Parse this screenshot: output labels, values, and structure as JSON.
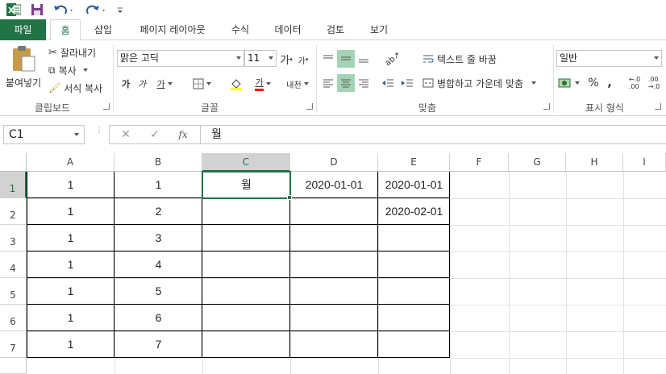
{
  "quick_access": {
    "app_icon": "excel-icon",
    "save_icon": "save-icon",
    "undo_icon": "undo-icon",
    "redo_icon": "redo-icon",
    "customize_icon": "customize-qat-icon"
  },
  "tabs": [
    "파일",
    "홈",
    "삽입",
    "페이지 레이아웃",
    "수식",
    "데이터",
    "검토",
    "보기"
  ],
  "ribbon": {
    "clipboard": {
      "paste": "붙여넣기",
      "cut": "잘라내기",
      "copy": "복사",
      "format_painter": "서식 복사",
      "label": "클립보드"
    },
    "font": {
      "name": "맑은 고딕",
      "size": "11",
      "grow": "가",
      "shrink": "가",
      "bold": "가",
      "italic": "가",
      "underline": "가",
      "font_color_glyph": "가",
      "phonetic": "내천",
      "label": "글꼴",
      "fill_color": "#ffff00",
      "font_color": "#ff0000"
    },
    "alignment": {
      "wrap_text": "텍스트 줄 바꿈",
      "merge_center": "병합하고 가운데 맞춤",
      "label": "맞춤"
    },
    "number": {
      "format": "일반",
      "percent": "%",
      "comma": ",",
      "label": "표시 형식"
    }
  },
  "formula_bar": {
    "name_box": "C1",
    "cancel": "✕",
    "enter": "✓",
    "fx": "fx",
    "content": "월"
  },
  "columns": [
    "A",
    "B",
    "C",
    "D",
    "E",
    "F",
    "G",
    "H",
    "I"
  ],
  "rows": [
    "1",
    "2",
    "3",
    "4",
    "5",
    "6",
    "7"
  ],
  "cells": [
    [
      "1",
      "1",
      "월",
      "2020-01-01",
      "2020-01-01",
      "",
      "",
      "",
      ""
    ],
    [
      "1",
      "2",
      "",
      "",
      "2020-02-01",
      "",
      "",
      "",
      ""
    ],
    [
      "1",
      "3",
      "",
      "",
      "",
      "",
      "",
      "",
      ""
    ],
    [
      "1",
      "4",
      "",
      "",
      "",
      "",
      "",
      "",
      ""
    ],
    [
      "1",
      "5",
      "",
      "",
      "",
      "",
      "",
      "",
      ""
    ],
    [
      "1",
      "6",
      "",
      "",
      "",
      "",
      "",
      "",
      ""
    ],
    [
      "1",
      "7",
      "",
      "",
      "",
      "",
      "",
      "",
      ""
    ]
  ],
  "selected_cell": "C1",
  "colors": {
    "excel_green": "#217346",
    "selected_align": "#a5d3b6"
  }
}
